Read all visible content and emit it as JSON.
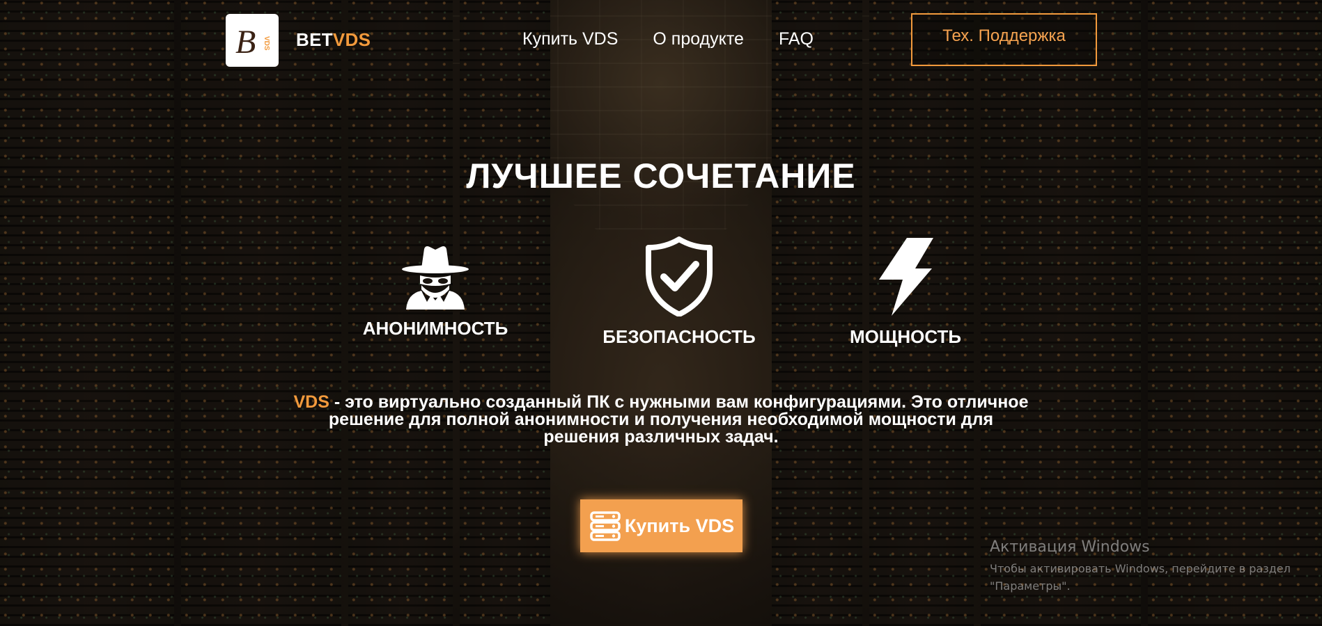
{
  "header": {
    "logo_letter": "B",
    "logo_mark_text": "VDS",
    "brand_part1": "BET",
    "brand_part2": "VDS",
    "nav": [
      {
        "label": "Купить VDS"
      },
      {
        "label": "О продукте"
      },
      {
        "label": "FAQ"
      }
    ],
    "support_label": "Тех. Поддержка"
  },
  "hero": {
    "title": "ЛУЧШЕЕ СОЧЕТАНИЕ",
    "features": [
      {
        "label": "АНОНИМНОСТЬ",
        "icon": "spy-icon"
      },
      {
        "label": "БЕЗОПАСНОСТЬ",
        "icon": "shield-check-icon"
      },
      {
        "label": "МОЩНОСТЬ",
        "icon": "lightning-icon"
      }
    ],
    "description_highlight": "VDS",
    "description_rest": " - это виртуально созданный ПК с нужными вам конфигурациями. Это отличное решение для полной анонимности и получения необходимой мощности для решения различных задач.",
    "buy_label": "Купить VDS",
    "buy_icon": "server-icon"
  },
  "watermark": {
    "title": "Активация Windows",
    "line1": "Чтобы активировать Windows, перейдите в раздел",
    "line2": "\"Параметры\"."
  },
  "colors": {
    "accent": "#f29a3c",
    "button_fill": "#f3a04f",
    "text": "#ffffff"
  }
}
